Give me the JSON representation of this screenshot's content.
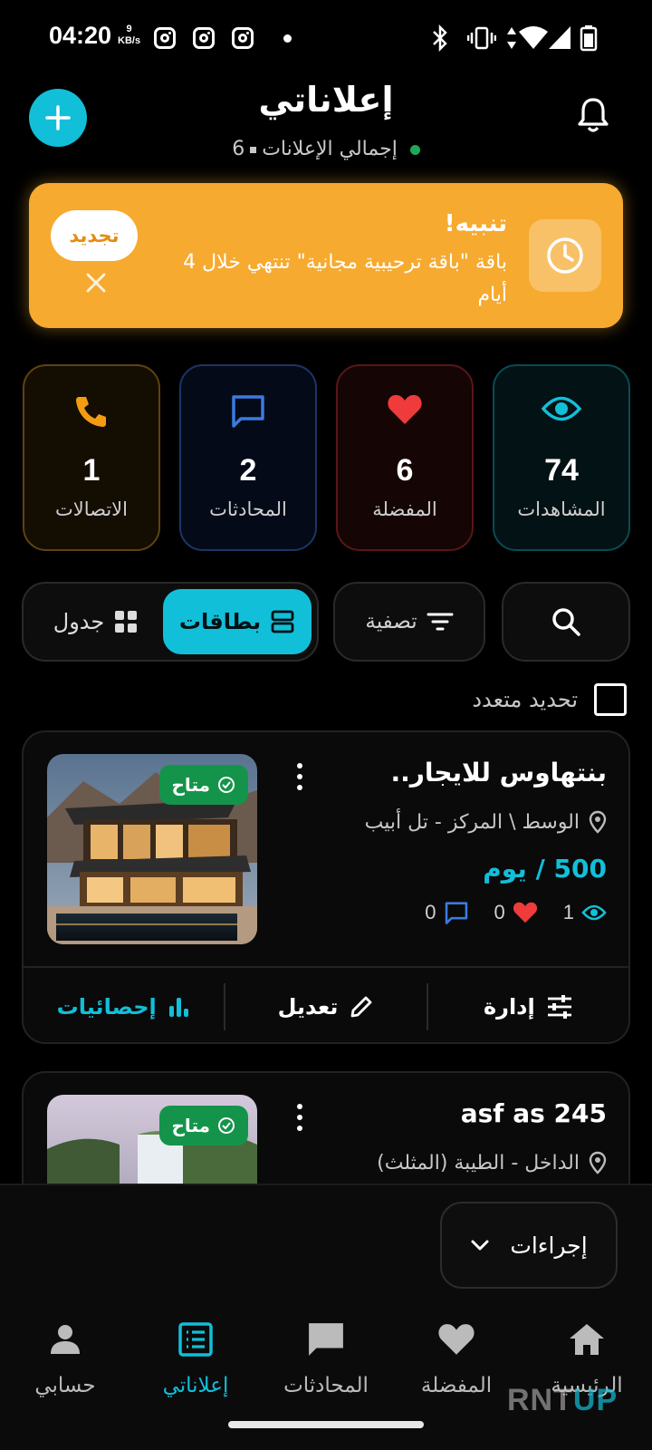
{
  "status_bar": {
    "time": "04:20",
    "net_speed_value": "9",
    "net_speed_unit": "KB/s"
  },
  "header": {
    "title": "إعلاناتي",
    "total_label": "إجمالي الإعلانات",
    "total_count": "6"
  },
  "alert": {
    "title": "تنبيه!",
    "message": "باقة \"باقة ترحيبية مجانية\" تنتهي خلال 4 أيام",
    "renew_label": "تجديد"
  },
  "stats": [
    {
      "label": "المشاهدات",
      "value": "74",
      "icon": "eye-icon",
      "color": "#12bfd9"
    },
    {
      "label": "المفضلة",
      "value": "6",
      "icon": "heart-icon",
      "color": "#ef3b3b"
    },
    {
      "label": "المحادثات",
      "value": "2",
      "icon": "chat-icon",
      "color": "#3b7be0"
    },
    {
      "label": "الاتصالات",
      "value": "1",
      "icon": "phone-icon",
      "color": "#f39c12"
    }
  ],
  "toolbar": {
    "filter_label": "تصفية",
    "cards_label": "بطاقات",
    "table_label": "جدول"
  },
  "multi_select_label": "تحديد متعدد",
  "listings": [
    {
      "title": "بنتهاوس للايجار..",
      "status": "متاح",
      "location": "الوسط \\ المركز - تل أبيب",
      "price": "500 / يوم",
      "views": "1",
      "favorites": "0",
      "messages": "0"
    },
    {
      "title": "asf as 245",
      "status": "متاح",
      "location": "الداخل - الطيبة (المثلث)"
    }
  ],
  "card_actions": {
    "manage": "إدارة",
    "edit": "تعديل",
    "stats": "إحصائيات"
  },
  "actions_dropdown": "إجراءات",
  "bottom_nav": [
    {
      "label": "الرئيسية",
      "icon": "home-icon"
    },
    {
      "label": "المفضلة",
      "icon": "heart-icon"
    },
    {
      "label": "المحادثات",
      "icon": "chat-icon"
    },
    {
      "label": "إعلاناتي",
      "icon": "listings-icon",
      "active": true
    },
    {
      "label": "حسابي",
      "icon": "person-icon"
    }
  ],
  "watermark": {
    "part1": "RNT",
    "part2": "UP"
  },
  "colors": {
    "accent": "#12bfd9",
    "warning": "#f6aa2f",
    "success": "#14944a"
  }
}
